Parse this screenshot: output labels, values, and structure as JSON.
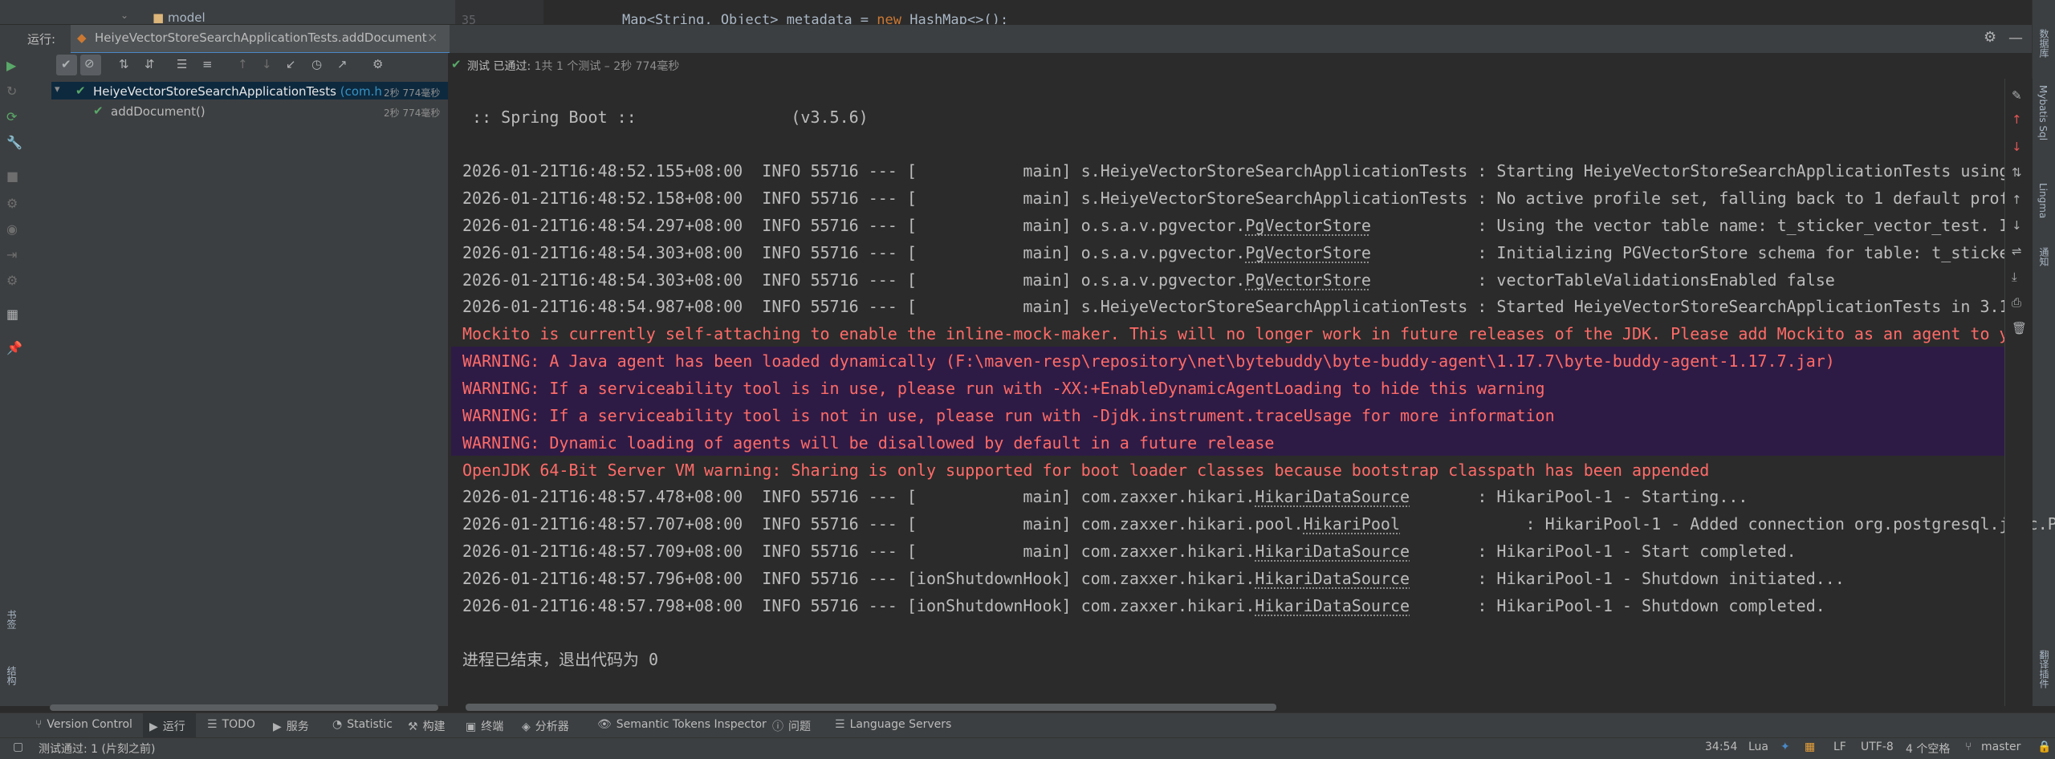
{
  "editor": {
    "tree_item": "model",
    "line_number": "35",
    "code_line": "Map<String, Object> metadata = ",
    "code_keyword": "new",
    "code_rest": " HashMap<>();"
  },
  "run_window": {
    "label": "运行:",
    "tab_title": "HeiyeVectorStoreSearchApplicationTests.addDocument",
    "status_prefix": "测试 已通过: ",
    "status_detail": "1共 1 个测试 – 2秒 774毫秒"
  },
  "test_tree": {
    "root": {
      "name": "HeiyeVectorStoreSearchApplicationTests",
      "package": "(com.h",
      "duration": "2秒 774毫秒"
    },
    "child": {
      "name": "addDocument()",
      "duration": "2秒 774毫秒"
    }
  },
  "console": {
    "banner": " :: Spring Boot ::                (v3.5.6)",
    "lines": [
      "2026-01-21T16:48:52.155+08:00  INFO 55716 --- [           main] s.HeiyeVectorStoreSearchApplicationTests : Starting HeiyeVectorStoreSearchApplicationTests using",
      "2026-01-21T16:48:52.158+08:00  INFO 55716 --- [           main] s.HeiyeVectorStoreSearchApplicationTests : No active profile set, falling back to 1 default prof",
      "2026-01-21T16:48:54.297+08:00  INFO 55716 --- [           main] o.s.a.v.pgvector.",
      "2026-01-21T16:48:54.303+08:00  INFO 55716 --- [           main] o.s.a.v.pgvector.",
      "2026-01-21T16:48:54.303+08:00  INFO 55716 --- [           main] o.s.a.v.pgvector.",
      "2026-01-21T16:48:54.987+08:00  INFO 55716 --- [           main] s.HeiyeVectorStoreSearchApplicationTests : Started HeiyeVectorStoreSearchApplicationTests in 3.1",
      "Mockito is currently self-attaching to enable the inline-mock-maker. This will no longer work in future releases of the JDK. Please add Mockito as an agent to y",
      "WARNING: A Java agent has been loaded dynamically (F:\\maven-resp\\repository\\net\\bytebuddy\\byte-buddy-agent\\1.17.7\\byte-buddy-agent-1.17.7.jar)",
      "WARNING: If a serviceability tool is in use, please run with -XX:+EnableDynamicAgentLoading to hide this warning",
      "WARNING: If a serviceability tool is not in use, please run with -Djdk.instrument.traceUsage for more information",
      "WARNING: Dynamic loading of agents will be disallowed by default in a future release",
      "OpenJDK 64-Bit Server VM warning: Sharing is only supported for boot loader classes because bootstrap classpath has been appended",
      "2026-01-21T16:48:57.478+08:00  INFO 55716 --- [           main] com.zaxxer.hikari.",
      "2026-01-21T16:48:57.707+08:00  INFO 55716 --- [           main] com.zaxxer.hikari.pool.",
      "2026-01-21T16:48:57.709+08:00  INFO 55716 --- [           main] com.zaxxer.hikari.",
      "2026-01-21T16:48:57.796+08:00  INFO 55716 --- [ionShutdownHook] com.zaxxer.hikari.",
      "2026-01-21T16:48:57.798+08:00  INFO 55716 --- [ionShutdownHook] com.zaxxer.hikari.",
      "进程已结束，退出代码为 0"
    ],
    "underlined": [
      "PgVectorStore",
      "PgVectorStore",
      "PgVectorStore",
      "HikariDataSource",
      "HikariPool",
      "HikariDataSource",
      "HikariDataSource",
      "HikariDataSource"
    ],
    "tails": [
      "           : Using the vector table name: t_sticker_vector_test. I",
      "           : Initializing PGVectorStore schema for table: t_sticke",
      "           : vectorTableValidationsEnabled false",
      "       : HikariPool-1 - Starting...",
      "             : HikariPool-1 - Added connection org.postgresql.jdbc.P",
      "       : HikariPool-1 - Start completed.",
      "       : HikariPool-1 - Shutdown initiated...",
      "       : HikariPool-1 - Shutdown completed."
    ]
  },
  "bottom_tabs": [
    "Version Control",
    "运行",
    "TODO",
    "服务",
    "Statistic",
    "构建",
    "终端",
    "分析器",
    "Semantic Tokens Inspector",
    "问题",
    "Language Servers"
  ],
  "right_stripe": [
    "数据库",
    "Mybatis Sql",
    "Lingma",
    "通知",
    "翻译插件"
  ],
  "left_stripe": [
    "书签",
    "结构"
  ],
  "status_bar": {
    "message": "测试通过: 1 (片刻之前)",
    "position": "34:54",
    "language": "Lua",
    "line_sep": "LF",
    "encoding": "UTF-8",
    "indent": "4 个空格",
    "branch": "master"
  },
  "colors": {
    "accent": "#4a88c7",
    "pass_green": "#59a869",
    "error_red": "#ff6b68",
    "warning_band": "#2e1b45"
  }
}
